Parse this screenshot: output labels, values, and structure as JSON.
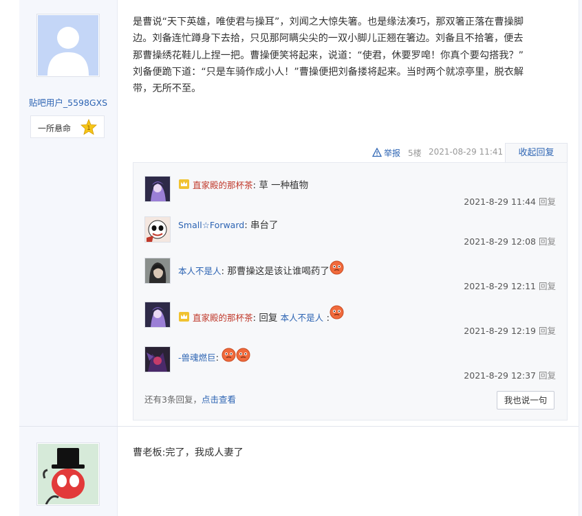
{
  "post1": {
    "author": {
      "username": "贴吧用户_5598GXS",
      "badge_title": "一所悬命",
      "badge_level": "1"
    },
    "content_lines": [
      "是曹说“天下英雄，唯使君与操耳”，刘闻之大惊失箸。也是缘法凑巧，那双箸正落在曹操脚",
      "边。刘备连忙蹲身下去拾，只见那阿瞒尖尖的一双小脚儿正翘在箸边。刘备且不拾箸，便去",
      "那曹操绣花鞋儿上捏一把。曹操便笑将起来，说道：“使君，休要罗唣！你真个要勾搭我？”",
      "刘备便跪下道：“只是车骑作成小人！”曹操便把刘备搂将起来。当时两个就凉亭里，脱衣解",
      "带，无所不至。"
    ],
    "meta": {
      "report_label": "举报",
      "floor": "5楼",
      "time": "2021-08-29 11:41",
      "collapse_label": "收起回复"
    },
    "replies": [
      {
        "name": "直家殿的那杯茶",
        "sep": ":",
        "text": " 草 一种植物",
        "time": "2021-8-29 11:44",
        "reply_label": "回复"
      },
      {
        "name": "Small☆Forward",
        "sep": ":",
        "text": " 串台了",
        "time": "2021-8-29 12:08",
        "reply_label": "回复"
      },
      {
        "name": "本人不是人",
        "sep": ":",
        "text": " 那曹操这是该让谁喝药了",
        "time": "2021-8-29 12:11",
        "reply_label": "回复"
      },
      {
        "name": "直家殿的那杯茶",
        "sep": ":",
        "text": " 回复 ",
        "mention": "本人不是人",
        "text2": " :",
        "time": "2021-8-29 12:19",
        "reply_label": "回复"
      },
      {
        "name": "-兽魂燃巨",
        "sep": ":",
        "text": " ",
        "time": "2021-8-29 12:37",
        "reply_label": "回复"
      }
    ],
    "more_prefix": "还有3条回复，",
    "more_link": "点击查看",
    "say_button": "我也说一句"
  },
  "post2": {
    "content": "曹老板:完了，我成人妻了"
  },
  "colors": {
    "link_blue": "#2d64b3",
    "vip_red": "#c0392b",
    "side_bg": "#f5f7fc",
    "panel_bg": "#f7f8fa"
  },
  "icons": {
    "report": "warning-triangle-icon",
    "vip": "vip-crown-icon",
    "emoji": "angry-face-emoji",
    "badge": "star-level-icon"
  }
}
